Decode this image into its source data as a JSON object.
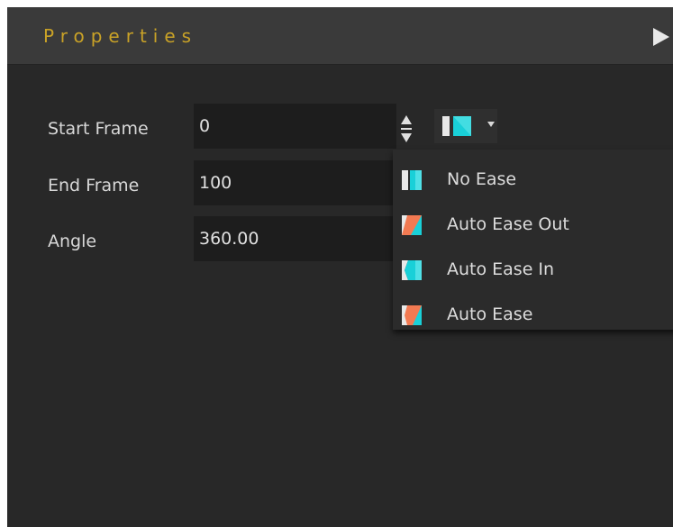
{
  "panel": {
    "title": "Properties"
  },
  "fields": [
    {
      "label": "Start Frame",
      "value": "0"
    },
    {
      "label": "End Frame",
      "value": "100"
    },
    {
      "label": "Angle",
      "value": "360.00"
    }
  ],
  "ease_menu": {
    "items": [
      {
        "label": "No Ease",
        "icon": "no-ease-icon"
      },
      {
        "label": "Auto Ease Out",
        "icon": "auto-ease-out-icon"
      },
      {
        "label": "Auto Ease In",
        "icon": "auto-ease-in-icon"
      },
      {
        "label": "Auto Ease",
        "icon": "auto-ease-icon"
      }
    ]
  },
  "colors": {
    "title": "#c9a227",
    "cyan": "#19d0d8",
    "orange": "#f27a52",
    "background": "#282828",
    "header": "#3a3a3a"
  }
}
